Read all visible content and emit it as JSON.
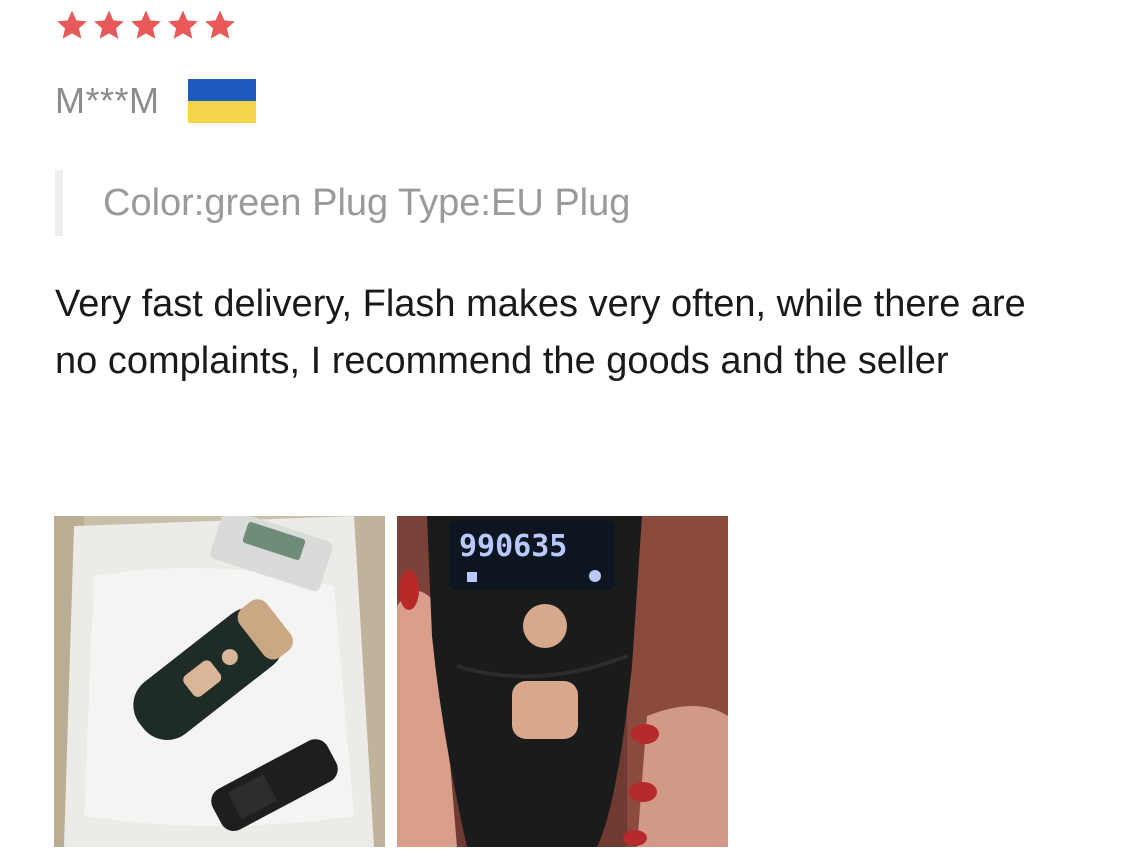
{
  "review": {
    "rating": 5,
    "rating_max": 5,
    "star_color": "#e8595a",
    "reviewer": {
      "name": "M***M",
      "country_flag_icon": "ukraine-flag-icon",
      "flag_colors": [
        "#1e5bbf",
        "#f7d54a"
      ]
    },
    "sku_text": "Color:green Plug Type:EU Plug",
    "text": "Very fast delivery, Flash makes very often, while there are no complaints, I recommend the goods and the seller",
    "photos": [
      {
        "icon": "packaged-device-photo"
      },
      {
        "icon": "device-in-hand-photo",
        "display_text": "990635"
      }
    ]
  }
}
